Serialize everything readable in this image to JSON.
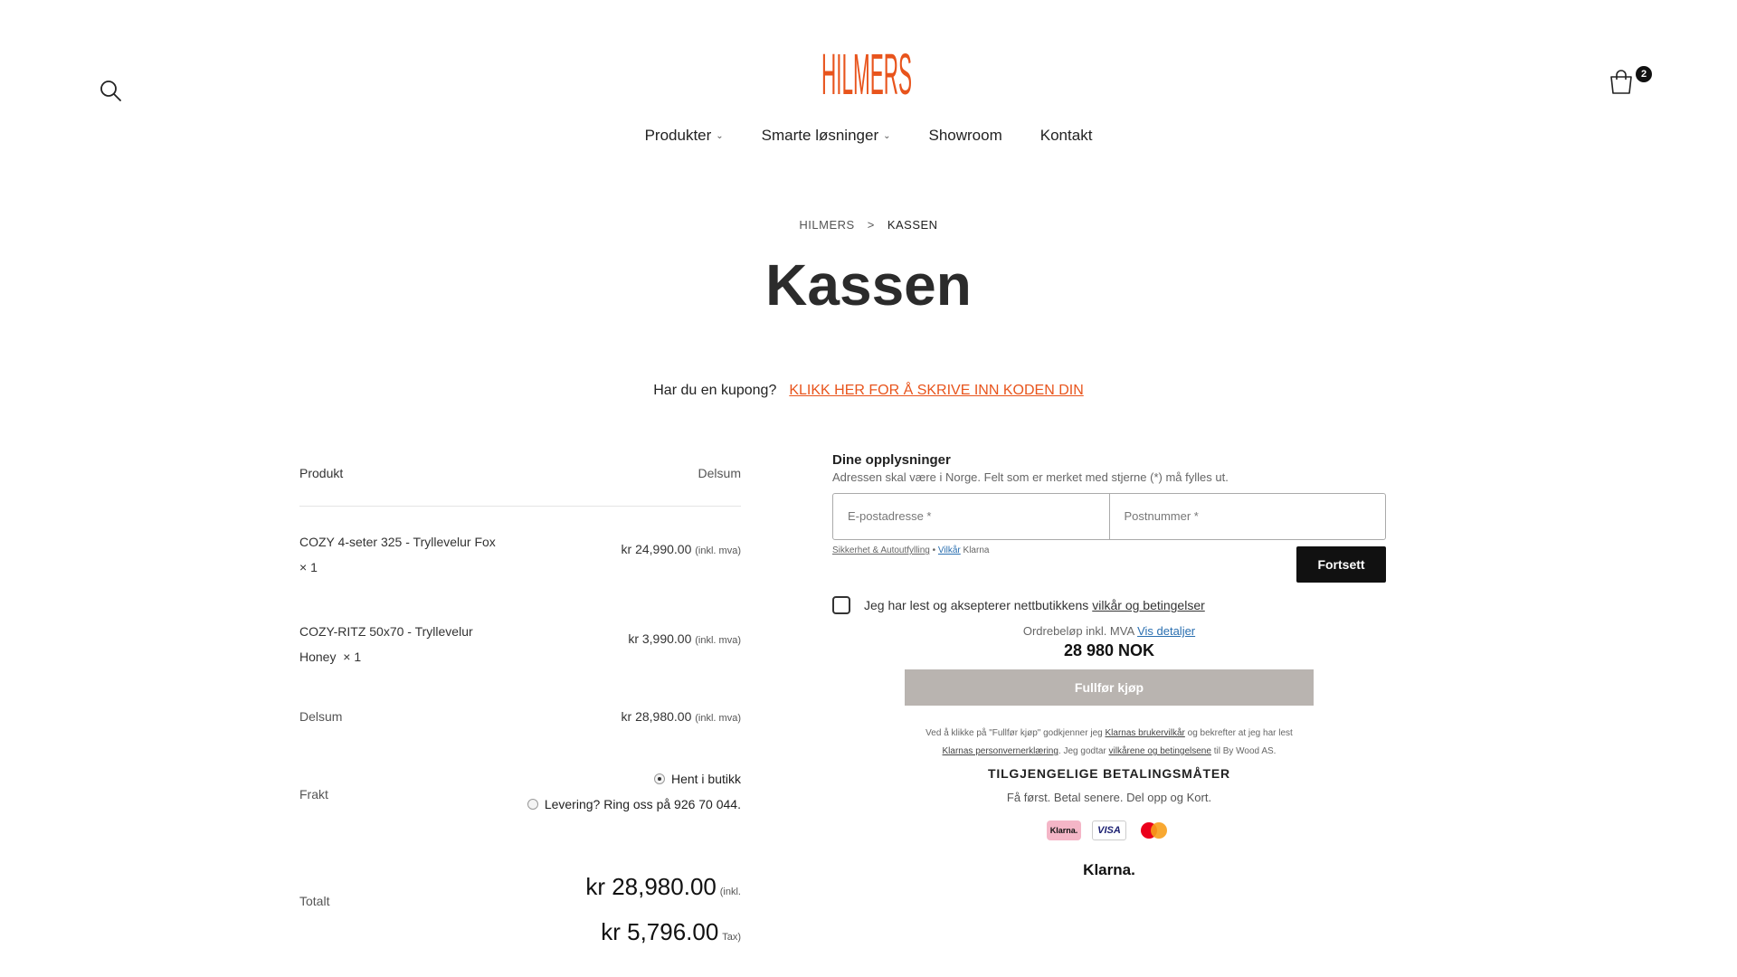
{
  "header": {
    "logo_text": "HILMERS",
    "cart_count": "2",
    "nav": [
      {
        "label": "Produkter"
      },
      {
        "label": "Smarte løsninger"
      },
      {
        "label": "Showroom"
      },
      {
        "label": "Kontakt"
      }
    ]
  },
  "breadcrumb": {
    "home": "HILMERS",
    "separator": ">",
    "current": "KASSEN"
  },
  "page_title": "Kassen",
  "coupon": {
    "question": "Har du en kupong?",
    "link": "KLIKK HER FOR Å SKRIVE INN KODEN DIN"
  },
  "order": {
    "col_product": "Produkt",
    "col_subtotal": "Delsum",
    "items": [
      {
        "name": "COZY 4-seter 325 - Tryllevelur Fox",
        "qty": "× 1",
        "price": "kr 24,990.00",
        "tax_note": "(inkl. mva)"
      },
      {
        "name": "COZY-RITZ 50x70 - Tryllevelur Honey",
        "name_line1": "COZY-RITZ 50x70 - Tryllevelur",
        "name_line2": "Honey",
        "qty": "× 1",
        "price": "kr 3,990.00",
        "tax_note": "(inkl. mva)"
      }
    ],
    "subtotal_label": "Delsum",
    "subtotal_value": "kr 28,980.00",
    "subtotal_note": "(inkl. mva)",
    "shipping_label": "Frakt",
    "shipping_options": [
      {
        "label": "Hent i butikk",
        "selected": true
      },
      {
        "label": "Levering? Ring oss på 926 70 044.",
        "selected": false
      }
    ],
    "total_label": "Totalt",
    "total_value": "kr 28,980.00",
    "total_note": "(inkl.",
    "tax_value": "kr 5,796.00",
    "tax_note": "Tax)"
  },
  "klarna": {
    "heading": "Dine opplysninger",
    "subheading": "Adressen skal være i Norge. Felt som er merket med stjerne (*) må fylles ut.",
    "email_placeholder": "E-postadresse *",
    "postcode_placeholder": "Postnummer *",
    "link_security": "Sikkerhet & Autoutfylling",
    "link_bullet": "•",
    "link_terms": "Vilkår",
    "link_brand": "Klarna",
    "continue_label": "Fortsett",
    "terms_text": "Jeg har lest og aksepterer nettbutikkens",
    "terms_link": "vilkår og betingelser",
    "amount_label": "Ordrebeløp inkl. MVA",
    "amount_link": "Vis detaljer",
    "amount": "28 980 NOK",
    "complete_label": "Fullfør kjøp",
    "legal_1": "Ved å klikke på \"Fullfør kjøp\" godkjenner jeg",
    "legal_link1": "Klarnas brukervilkår",
    "legal_2": "og bekrefter at jeg har lest",
    "legal_link2": "Klarnas personvernerklæring",
    "legal_3": ". Jeg godtar",
    "legal_link3": "vilkårene og betingelsene",
    "legal_4": "til By Wood AS.",
    "payments_title": "TILGJENGELIGE BETALINGSMÅTER",
    "payments_sub": "Få først. Betal senere. Del opp og Kort.",
    "badge_klarna": "Klarna.",
    "badge_visa": "VISA",
    "footer_logo": "Klarna."
  },
  "colors": {
    "accent": "#e8541c",
    "button_dark": "#111111",
    "button_disabled": "#b9b4b0",
    "link_blue": "#2a6fb0"
  },
  "icons": [
    "search-icon",
    "cart-icon",
    "chevron-down-icon",
    "visa-icon",
    "mastercard-icon",
    "klarna-icon"
  ]
}
